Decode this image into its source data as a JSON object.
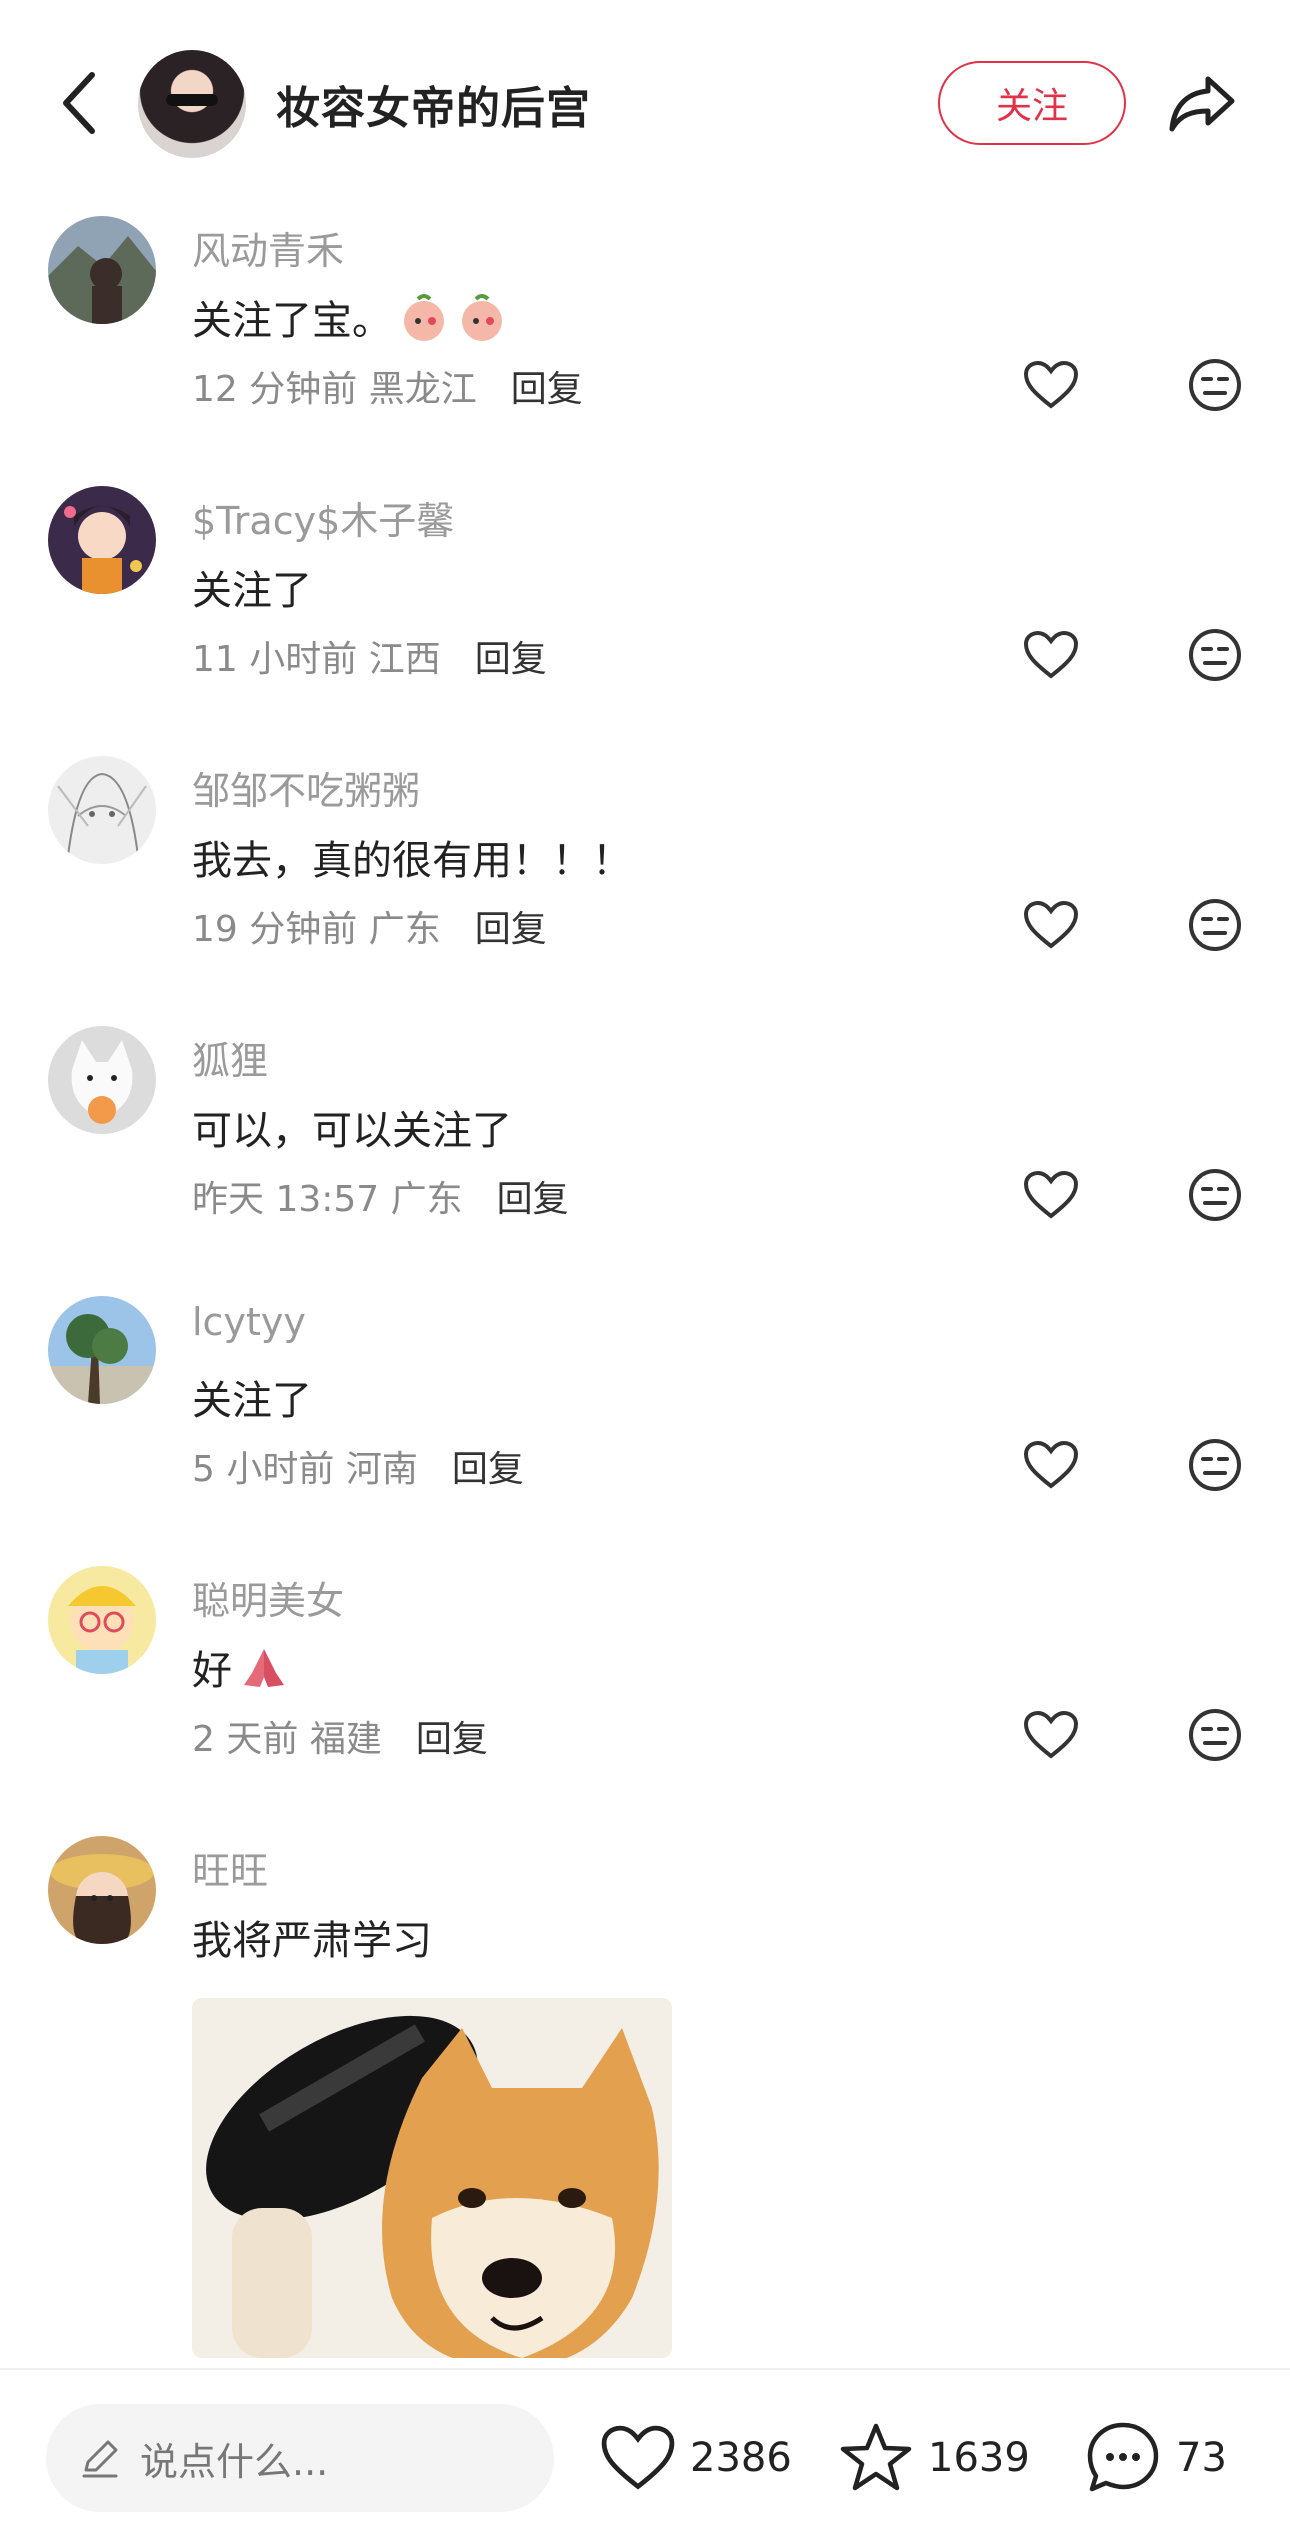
{
  "header": {
    "author_name": "妆容女帝的后宫",
    "follow_label": "关注"
  },
  "comments": [
    {
      "name": "风动青禾",
      "text": "关注了宝。",
      "time": "12 分钟前",
      "location": "黑龙江",
      "reply_label": "回复",
      "emoji_count": 2
    },
    {
      "name": "$Tracy$木子馨",
      "text": "关注了",
      "time": "11 小时前",
      "location": "江西",
      "reply_label": "回复"
    },
    {
      "name": "邹邹不吃粥粥",
      "text": "我去，真的很有用！！！",
      "time": "19 分钟前",
      "location": "广东",
      "reply_label": "回复"
    },
    {
      "name": "狐狸",
      "text": "可以，可以关注了",
      "time": "昨天 13:57",
      "location": "广东",
      "reply_label": "回复"
    },
    {
      "name": "lcytyy",
      "text": "关注了",
      "time": "5 小时前",
      "location": "河南",
      "reply_label": "回复"
    },
    {
      "name": "聪明美女",
      "text": "好",
      "time": "2 天前",
      "location": "福建",
      "reply_label": "回复",
      "emoji": "praying-hands"
    },
    {
      "name": "旺旺",
      "text": "我将严肃学习"
    }
  ],
  "bottom_bar": {
    "input_placeholder": "说点什么...",
    "likes": "2386",
    "favorites": "1639",
    "comments": "73"
  },
  "colors": {
    "accent": "#e0334a",
    "name_gray": "#9a9a9a",
    "meta_gray": "#8a8a8a"
  },
  "icons": {
    "back": "chevron-left-icon",
    "share": "share-arrow-icon",
    "like": "heart-icon",
    "emoji": "neutral-face-icon",
    "input": "pencil-icon",
    "favorite": "star-icon",
    "comment": "speech-bubble-icon"
  }
}
